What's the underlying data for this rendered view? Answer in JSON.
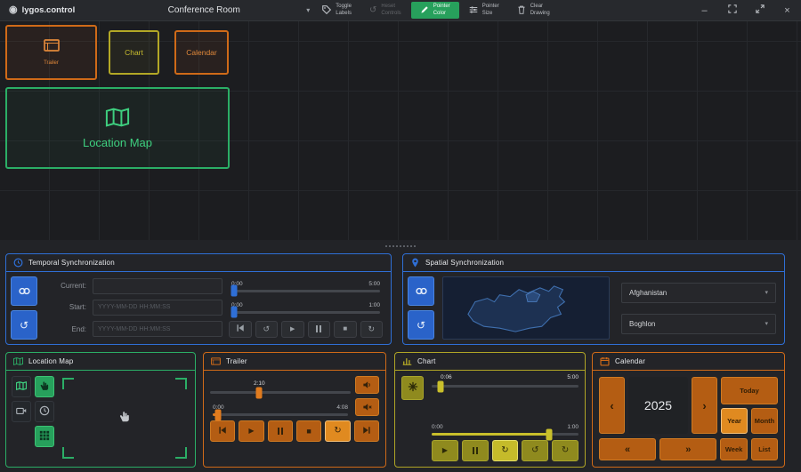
{
  "colors": {
    "accent_orange": "#cf6a18",
    "accent_olive": "#b0a526",
    "accent_green": "#2bae66",
    "accent_blue": "#2f6fd6",
    "pointer_color_button": "#27a05c"
  },
  "titlebar": {
    "app_name": "lygos.control",
    "room": "Conference Room",
    "toolbar": {
      "toggle_labels": [
        "Toggle",
        "Labels"
      ],
      "reset_controls": [
        "Reset",
        "Controls"
      ],
      "pointer_color": [
        "Pointer",
        "Color"
      ],
      "pointer_size": [
        "Pointer",
        "Size"
      ],
      "clear_drawing": [
        "Clear",
        "Drawing"
      ]
    }
  },
  "canvas": {
    "trailer": "Trailer",
    "chart": "Chart",
    "calendar": "Calendar",
    "location_map": "Location Map"
  },
  "temporal": {
    "title": "Temporal Synchronization",
    "current": "Current:",
    "start": "Start:",
    "end": "End:",
    "placeholder": "YYYY-MM-DD HH:MM:SS",
    "s1_min": "0:00",
    "s1_max": "5:00",
    "s2_min": "0:00",
    "s2_max": "1:00"
  },
  "spatial": {
    "title": "Spatial Synchronization",
    "country": "Afghanistan",
    "region": "Boghlon"
  },
  "map_panel": {
    "title": "Location Map"
  },
  "trailer_panel": {
    "title": "Trailer",
    "seek_value": "2:10",
    "time_cur": "0:00",
    "time_end": "4:08"
  },
  "chart_panel": {
    "title": "Chart",
    "seek_value": "0:06",
    "seek_max": "5:00",
    "range_min": "0:00",
    "range_max": "1:00"
  },
  "calendar_panel": {
    "title": "Calendar",
    "year": "2025",
    "today": "Today",
    "year_view": "Year",
    "month_view": "Month",
    "week_view": "Week",
    "list_view": "List"
  },
  "icons": {
    "logo": "◉",
    "chevron_down": "▾",
    "minimize": "–",
    "close": "×",
    "play": "▶",
    "stop": "■",
    "repeat": "↻",
    "rotate_ccw": "↺",
    "prev": "‹",
    "next": "›",
    "prev_double": "«",
    "next_double": "»"
  }
}
